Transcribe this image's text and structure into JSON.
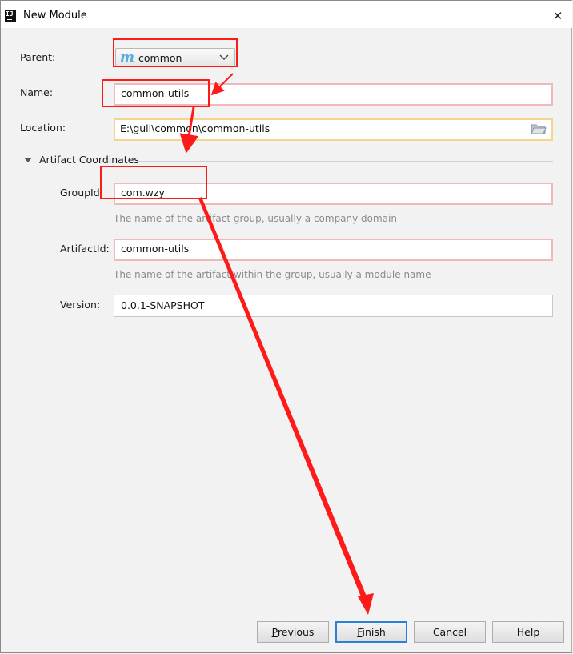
{
  "window": {
    "title": "New Module",
    "app_icon_text": "IJ"
  },
  "form": {
    "parent": {
      "label": "Parent:",
      "value": "common"
    },
    "name": {
      "label": "Name:",
      "value": "common-utils"
    },
    "location": {
      "label": "Location:",
      "value": "E:\\guli\\common\\common-utils"
    }
  },
  "artifact": {
    "section_title": "Artifact Coordinates",
    "group_id": {
      "label": "GroupId:",
      "value": "com.wzy",
      "help": "The name of the artifact group, usually a company domain"
    },
    "artifact_id": {
      "label": "ArtifactId:",
      "value": "common-utils",
      "help": "The name of the artifact within the group, usually a module name"
    },
    "version": {
      "label": "Version:",
      "value": "0.0.1-SNAPSHOT"
    }
  },
  "buttons": {
    "previous": {
      "mnemonic": "P",
      "rest": "revious"
    },
    "finish": {
      "mnemonic": "F",
      "rest": "inish"
    },
    "cancel": "Cancel",
    "help": "Help"
  },
  "icons": {
    "app": "intellij-icon",
    "close": "close-icon",
    "module": "maven-module-icon",
    "dropdown": "chevron-down-icon",
    "folder": "folder-icon",
    "section": "triangle-down-icon"
  },
  "colors": {
    "annotation": "#ff1a1a",
    "focus": "#2a82d8",
    "error_border": "#f0b8b8",
    "warning_border": "#f6d48c"
  }
}
